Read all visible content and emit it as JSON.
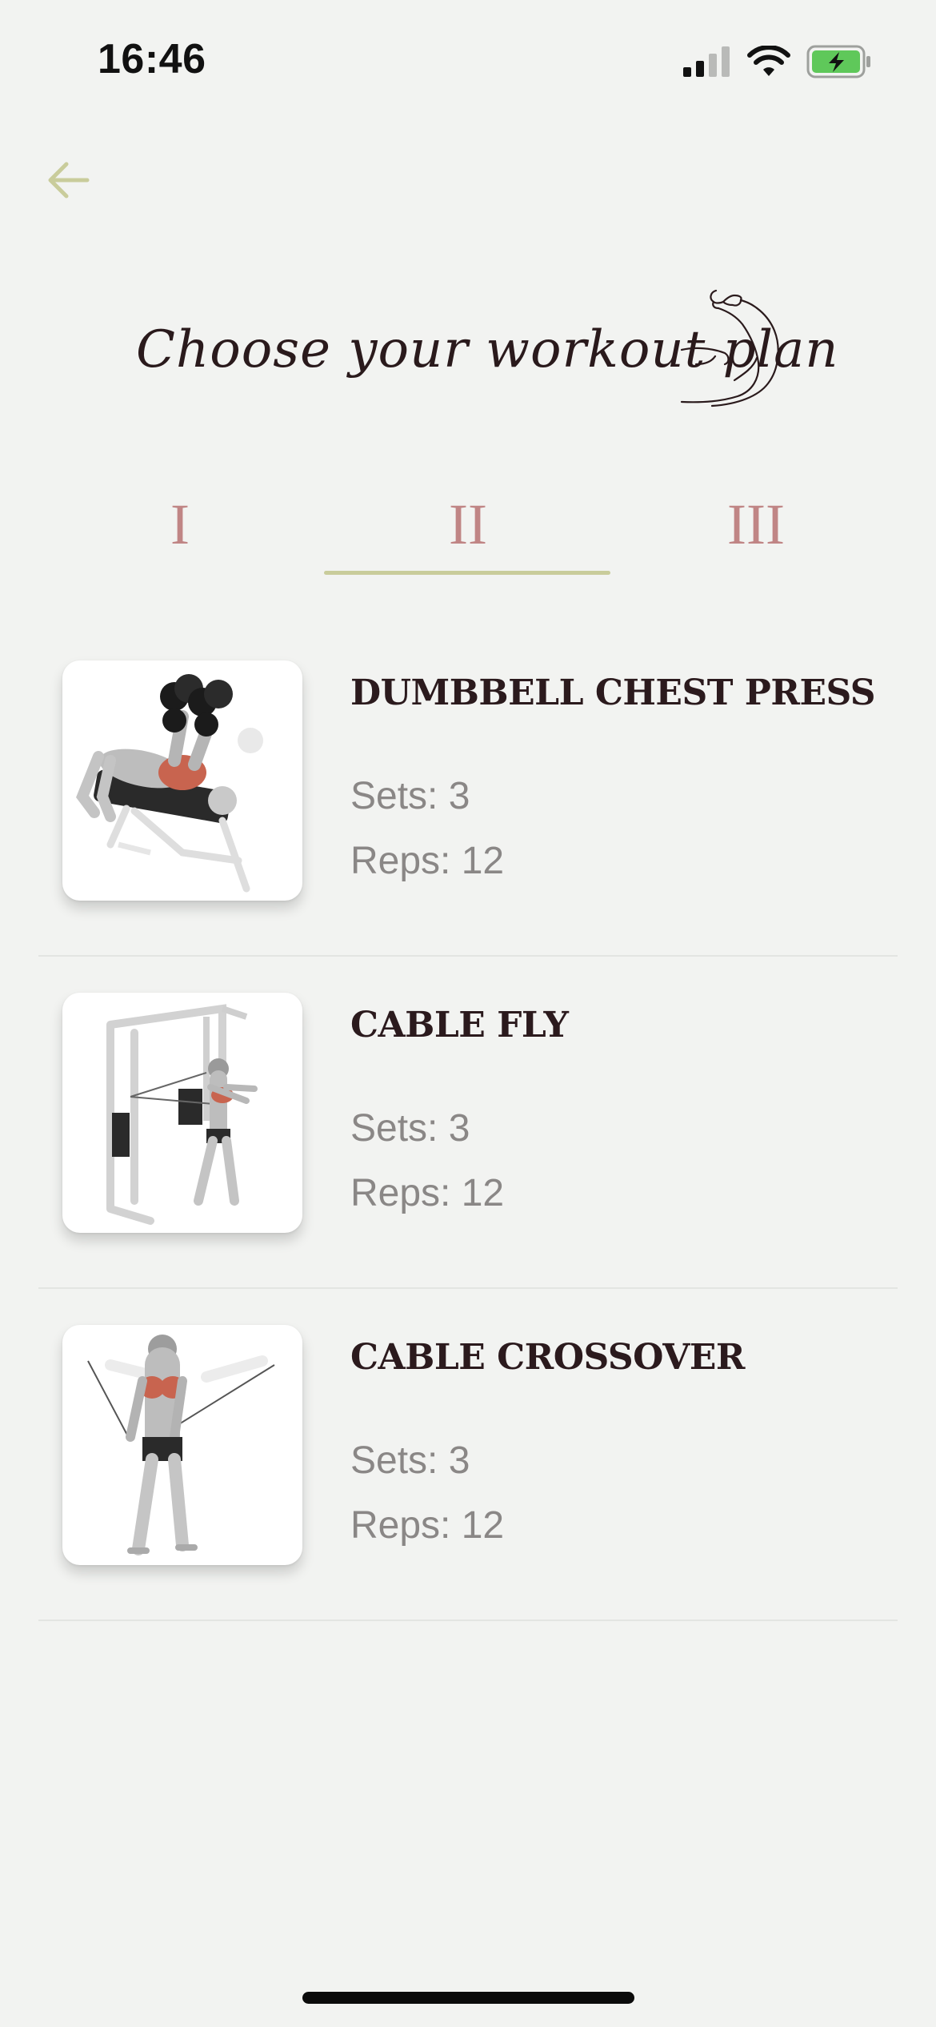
{
  "status_bar": {
    "time": "16:46",
    "icons": [
      "cellular-signal-icon",
      "wifi-icon",
      "battery-charging-icon"
    ]
  },
  "navigation": {
    "back_icon": "arrow-left-icon"
  },
  "header": {
    "title": "Choose your workout plan",
    "icon": "flexed-bicep-icon"
  },
  "tabs": {
    "items": [
      {
        "label": "I"
      },
      {
        "label": "II"
      },
      {
        "label": "III"
      }
    ],
    "selected_index": 1
  },
  "exercises": [
    {
      "name": "DUMBBELL CHEST PRESS",
      "sets": "Sets: 3",
      "reps": "Reps: 12",
      "image_icon": "dumbbell-chest-press-illustration"
    },
    {
      "name": "CABLE FLY",
      "sets": "Sets: 3",
      "reps": "Reps: 12",
      "image_icon": "cable-fly-illustration"
    },
    {
      "name": "CABLE CROSSOVER",
      "sets": "Sets: 3",
      "reps": "Reps: 12",
      "image_icon": "cable-crossover-illustration"
    }
  ],
  "colors": {
    "background": "#f2f3f1",
    "accent_green": "#c9cc9b",
    "tab_text": "#c08585",
    "title_text": "#2a1a1c",
    "muted_text": "#8a8786",
    "muscle_highlight": "#c8644f"
  }
}
